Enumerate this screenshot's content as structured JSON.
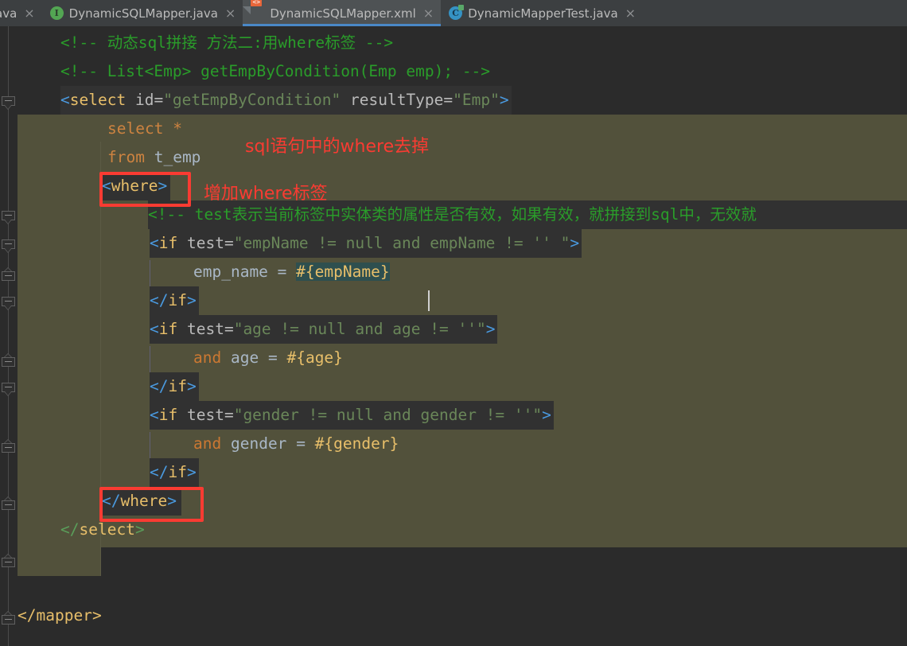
{
  "window": {
    "app": "IntelliJ IDEA Editor",
    "background_dark": "#2b2b2b",
    "selection_olive": "#52513b",
    "annotation_red": "#fa3b32",
    "active_tab_underline": "#4a88c7"
  },
  "tabbar": {
    "tabs": [
      {
        "label": "ava",
        "icon": "java-file-icon",
        "close": "×",
        "active": false,
        "clipped": true
      },
      {
        "label": "DynamicSQLMapper.java",
        "icon": "interface-icon",
        "icon_glyph": "I",
        "close": "×",
        "active": false,
        "clipped": false
      },
      {
        "label": "DynamicSQLMapper.xml",
        "icon": "xml-file-icon",
        "icon_glyph": "<>",
        "close": "×",
        "active": true,
        "clipped": false
      },
      {
        "label": "DynamicMapperTest.java",
        "icon": "class-icon",
        "icon_glyph": "C",
        "close": "×",
        "active": false,
        "clipped": false
      }
    ]
  },
  "editor": {
    "language": "XML",
    "file": "DynamicSQLMapper.xml",
    "lines": [
      {
        "id": "comment-dynamic-sql",
        "text": "<!-- 动态sql拼接 方法二:用where标签 -->"
      },
      {
        "id": "comment-method-signature",
        "text": "<!-- List<Emp> getEmpByCondition(Emp emp); -->"
      },
      {
        "id": "select-open-tag",
        "text": "<select id=\"getEmpByCondition\" resultType=\"Emp\">"
      },
      {
        "id": "sql-select-star",
        "text": "select *"
      },
      {
        "id": "sql-from",
        "text": "from t_emp"
      },
      {
        "id": "where-open-tag",
        "text": "<where>"
      },
      {
        "id": "comment-test-desc",
        "text": "<!-- test表示当前标签中实体类的属性是否有效，如果有效，就拼接到sql中，无效就"
      },
      {
        "id": "if-empname-open",
        "text": "<if test=\"empName != null and empName != '' \">"
      },
      {
        "id": "sql-empname-cond",
        "text": "emp_name = #{empName}"
      },
      {
        "id": "if-empname-close",
        "text": "</if>"
      },
      {
        "id": "if-age-open",
        "text": "<if test=\"age != null and age != ''\">"
      },
      {
        "id": "sql-age-cond",
        "text": "and age = #{age}"
      },
      {
        "id": "if-age-close",
        "text": "</if>"
      },
      {
        "id": "if-gender-open",
        "text": "<if test=\"gender != null and gender != ''\">"
      },
      {
        "id": "sql-gender-cond",
        "text": "and gender = #{gender}"
      },
      {
        "id": "if-gender-close",
        "text": "</if>"
      },
      {
        "id": "where-close-tag",
        "text": "</where>"
      },
      {
        "id": "select-close-tag",
        "text": "</select>"
      },
      {
        "id": "mapper-close-tag",
        "text": "</mapper>"
      }
    ],
    "tokens": {
      "comment1_text": "<!-- 动态sql拼接 方法二:用where标签 -->",
      "comment2_text": "<!-- List<Emp> getEmpByCondition(Emp emp); -->",
      "comment3_text": "<!-- test表示当前标签中实体类的属性是否有效，如果有效，就拼接到sql中，无效就",
      "lt": "<",
      "gt": ">",
      "lt_slash": "</",
      "select_name": "select",
      "if_name": "if",
      "where_name": "where",
      "mapper_name": "mapper",
      "attr_id": "id",
      "attr_test": "test",
      "attr_resultType": "resultType",
      "eq": "=",
      "val_getEmpByCondition": "\"getEmpByCondition\"",
      "val_Emp": "\"Emp\"",
      "val_empName_test": "\"empName != null and empName != '' \"",
      "val_age_test": "\"age != null and age != ''\"",
      "val_gender_test": "\"gender != null and gender != ''\"",
      "kw_select": "select",
      "star": "*",
      "kw_from": "from",
      "tbl_t_emp": "t_emp",
      "kw_and": "and",
      "col_emp_name": "emp_name",
      "col_age": "age",
      "col_gender": "gender",
      "op_eq": "=",
      "p_empName": "#{empName}",
      "p_age": "#{age}",
      "p_gender": "#{gender}"
    }
  },
  "annotations": [
    {
      "id": "note-remove-where",
      "text": "sql语句中的where去掉"
    },
    {
      "id": "note-add-where-tag",
      "text": "增加where标签"
    }
  ],
  "redboxes": [
    {
      "id": "redbox-where-open"
    },
    {
      "id": "redbox-where-close"
    }
  ]
}
